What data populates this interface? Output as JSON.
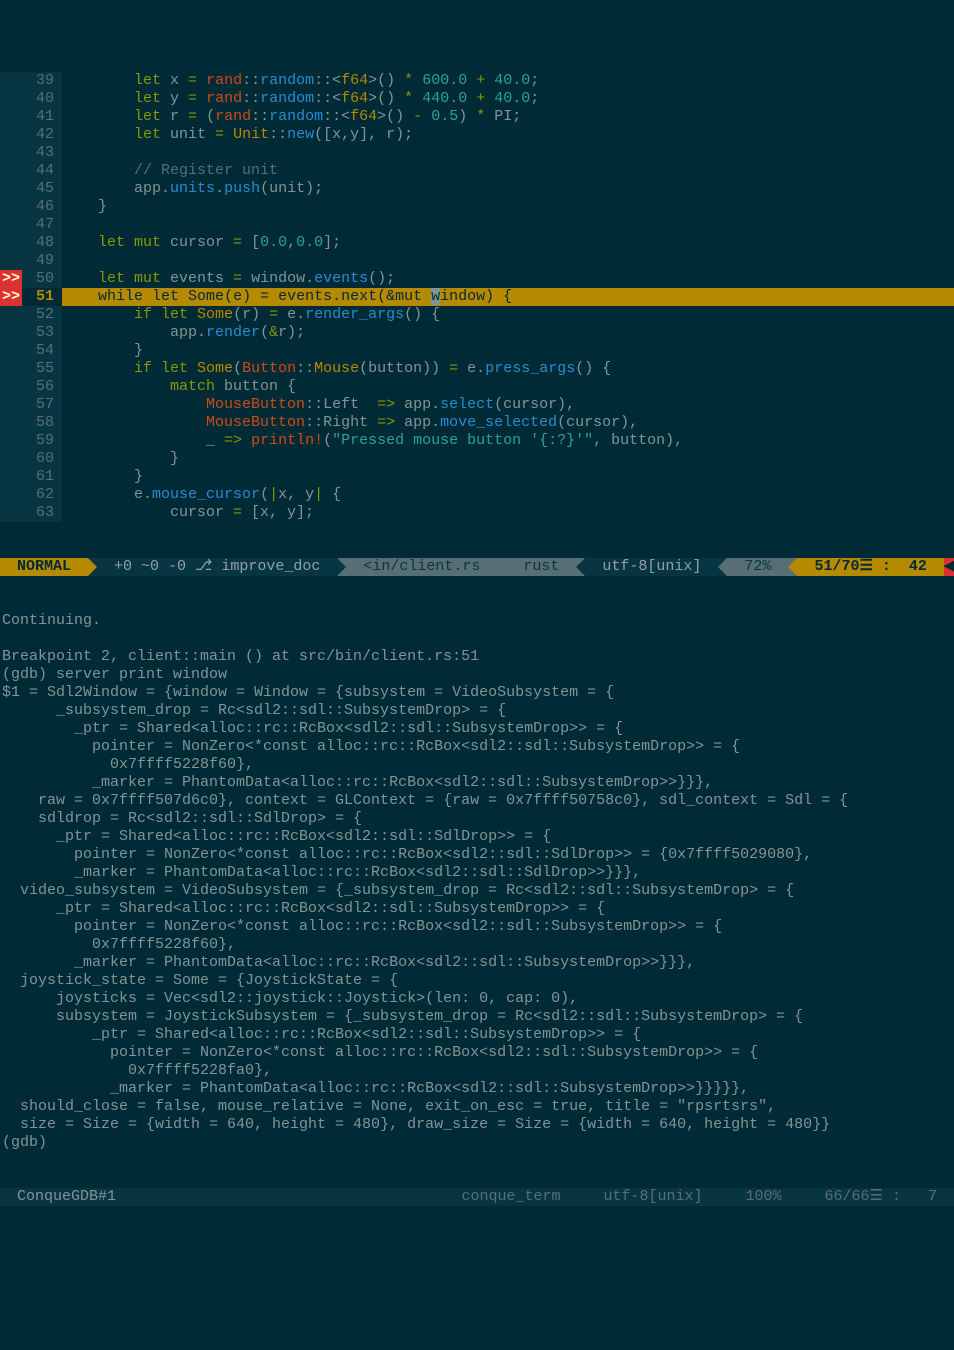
{
  "editor": {
    "lines": [
      {
        "n": 39,
        "sign": "",
        "segs": [
          [
            "        ",
            ""
          ],
          [
            "let",
            "kw"
          ],
          [
            " x ",
            ""
          ],
          [
            "=",
            "op"
          ],
          [
            " ",
            ""
          ],
          [
            "rand",
            "pth"
          ],
          [
            "::",
            ""
          ],
          [
            "random",
            "fn"
          ],
          [
            "::<",
            ""
          ],
          [
            "f64",
            "ty"
          ],
          [
            ">() ",
            ""
          ],
          [
            "*",
            "op"
          ],
          [
            " ",
            ""
          ],
          [
            "600.0",
            "num"
          ],
          [
            " ",
            ""
          ],
          [
            "+",
            "op"
          ],
          [
            " ",
            ""
          ],
          [
            "40.0",
            "num"
          ],
          [
            ";",
            ""
          ]
        ]
      },
      {
        "n": 40,
        "sign": "",
        "segs": [
          [
            "        ",
            ""
          ],
          [
            "let",
            "kw"
          ],
          [
            " y ",
            ""
          ],
          [
            "=",
            "op"
          ],
          [
            " ",
            ""
          ],
          [
            "rand",
            "pth"
          ],
          [
            "::",
            ""
          ],
          [
            "random",
            "fn"
          ],
          [
            "::<",
            ""
          ],
          [
            "f64",
            "ty"
          ],
          [
            ">() ",
            ""
          ],
          [
            "*",
            "op"
          ],
          [
            " ",
            ""
          ],
          [
            "440.0",
            "num"
          ],
          [
            " ",
            ""
          ],
          [
            "+",
            "op"
          ],
          [
            " ",
            ""
          ],
          [
            "40.0",
            "num"
          ],
          [
            ";",
            ""
          ]
        ]
      },
      {
        "n": 41,
        "sign": "",
        "segs": [
          [
            "        ",
            ""
          ],
          [
            "let",
            "kw"
          ],
          [
            " r ",
            ""
          ],
          [
            "=",
            "op"
          ],
          [
            " (",
            ""
          ],
          [
            "rand",
            "pth"
          ],
          [
            "::",
            ""
          ],
          [
            "random",
            "fn"
          ],
          [
            "::<",
            ""
          ],
          [
            "f64",
            "ty"
          ],
          [
            ">() ",
            ""
          ],
          [
            "-",
            "op"
          ],
          [
            " ",
            ""
          ],
          [
            "0.5",
            "num"
          ],
          [
            ") ",
            ""
          ],
          [
            "*",
            "op"
          ],
          [
            " ",
            ""
          ],
          [
            "PI",
            ""
          ],
          [
            ";",
            ""
          ]
        ]
      },
      {
        "n": 42,
        "sign": "",
        "segs": [
          [
            "        ",
            ""
          ],
          [
            "let",
            "kw"
          ],
          [
            " unit ",
            ""
          ],
          [
            "=",
            "op"
          ],
          [
            " ",
            ""
          ],
          [
            "Unit",
            "ty"
          ],
          [
            "::",
            ""
          ],
          [
            "new",
            "fn"
          ],
          [
            "([x,y], r);",
            ""
          ]
        ]
      },
      {
        "n": 43,
        "sign": "",
        "segs": [
          [
            "",
            ""
          ]
        ]
      },
      {
        "n": 44,
        "sign": "",
        "segs": [
          [
            "        ",
            ""
          ],
          [
            "// Register unit",
            "cm"
          ]
        ]
      },
      {
        "n": 45,
        "sign": "",
        "segs": [
          [
            "        app",
            ""
          ],
          [
            ".",
            ""
          ],
          [
            "units",
            "fn"
          ],
          [
            ".",
            ""
          ],
          [
            "push",
            "fn"
          ],
          [
            "(unit);",
            ""
          ]
        ]
      },
      {
        "n": 46,
        "sign": "",
        "segs": [
          [
            "    }",
            ""
          ]
        ]
      },
      {
        "n": 47,
        "sign": "",
        "segs": [
          [
            "",
            ""
          ]
        ]
      },
      {
        "n": 48,
        "sign": "",
        "segs": [
          [
            "    ",
            ""
          ],
          [
            "let mut",
            "kw"
          ],
          [
            " cursor ",
            ""
          ],
          [
            "=",
            "op"
          ],
          [
            " [",
            ""
          ],
          [
            "0.0",
            "num"
          ],
          [
            ",",
            ""
          ],
          [
            "0.0",
            "num"
          ],
          [
            "];",
            ""
          ]
        ]
      },
      {
        "n": 49,
        "sign": "",
        "segs": [
          [
            "",
            ""
          ]
        ]
      },
      {
        "n": 50,
        "sign": ">>",
        "segs": [
          [
            "    ",
            ""
          ],
          [
            "let mut",
            "kw"
          ],
          [
            " events ",
            ""
          ],
          [
            "=",
            "op"
          ],
          [
            " window",
            ""
          ],
          [
            ".",
            ""
          ],
          [
            "events",
            "fn"
          ],
          [
            "();",
            ""
          ]
        ]
      },
      {
        "n": 51,
        "sign": ">>",
        "cursor": true,
        "segs": [
          [
            "    ",
            ""
          ],
          [
            "while let",
            "kw"
          ],
          [
            " ",
            ""
          ],
          [
            "Some",
            "ty"
          ],
          [
            "(e) ",
            ""
          ],
          [
            "=",
            "op"
          ],
          [
            " events.next(",
            ""
          ],
          [
            "&mut",
            "kw"
          ],
          [
            " ",
            ""
          ],
          [
            "w",
            "",
            "cur"
          ],
          [
            "indow) {",
            ""
          ]
        ]
      },
      {
        "n": 52,
        "sign": "",
        "segs": [
          [
            "        ",
            ""
          ],
          [
            "if let",
            "kw"
          ],
          [
            " ",
            ""
          ],
          [
            "Some",
            "ty"
          ],
          [
            "(r) ",
            ""
          ],
          [
            "=",
            "op"
          ],
          [
            " e",
            ""
          ],
          [
            ".",
            ""
          ],
          [
            "render_args",
            "fn"
          ],
          [
            "() {",
            ""
          ]
        ]
      },
      {
        "n": 53,
        "sign": "",
        "segs": [
          [
            "            app",
            ""
          ],
          [
            ".",
            ""
          ],
          [
            "render",
            "fn"
          ],
          [
            "(",
            ""
          ],
          [
            "&",
            "op"
          ],
          [
            "r);",
            ""
          ]
        ]
      },
      {
        "n": 54,
        "sign": "",
        "segs": [
          [
            "        }",
            ""
          ]
        ]
      },
      {
        "n": 55,
        "sign": "",
        "segs": [
          [
            "        ",
            ""
          ],
          [
            "if let",
            "kw"
          ],
          [
            " ",
            ""
          ],
          [
            "Some",
            "ty"
          ],
          [
            "(",
            ""
          ],
          [
            "Button",
            "pth"
          ],
          [
            "::",
            ""
          ],
          [
            "Mouse",
            "ty"
          ],
          [
            "(button)) ",
            ""
          ],
          [
            "=",
            "op"
          ],
          [
            " e",
            ""
          ],
          [
            ".",
            ""
          ],
          [
            "press_args",
            "fn"
          ],
          [
            "() {",
            ""
          ]
        ]
      },
      {
        "n": 56,
        "sign": "",
        "segs": [
          [
            "            ",
            ""
          ],
          [
            "match",
            "kw"
          ],
          [
            " button {",
            ""
          ]
        ]
      },
      {
        "n": 57,
        "sign": "",
        "segs": [
          [
            "                ",
            ""
          ],
          [
            "MouseButton",
            "pth"
          ],
          [
            "::",
            ""
          ],
          [
            "Left  ",
            ""
          ],
          [
            "=>",
            "op"
          ],
          [
            " app",
            ""
          ],
          [
            ".",
            ""
          ],
          [
            "select",
            "fn"
          ],
          [
            "(cursor),",
            ""
          ]
        ]
      },
      {
        "n": 58,
        "sign": "",
        "segs": [
          [
            "                ",
            ""
          ],
          [
            "MouseButton",
            "pth"
          ],
          [
            "::",
            ""
          ],
          [
            "Right ",
            ""
          ],
          [
            "=>",
            "op"
          ],
          [
            " app",
            ""
          ],
          [
            ".",
            ""
          ],
          [
            "move_selected",
            "fn"
          ],
          [
            "(cursor),",
            ""
          ]
        ]
      },
      {
        "n": 59,
        "sign": "",
        "segs": [
          [
            "                _ ",
            ""
          ],
          [
            "=>",
            "op"
          ],
          [
            " ",
            ""
          ],
          [
            "println!",
            "pth"
          ],
          [
            "(",
            ""
          ],
          [
            "\"Pressed mouse button '{:?}'\"",
            "str"
          ],
          [
            ", button),",
            ""
          ]
        ]
      },
      {
        "n": 60,
        "sign": "",
        "segs": [
          [
            "            }",
            ""
          ]
        ]
      },
      {
        "n": 61,
        "sign": "",
        "segs": [
          [
            "        }",
            ""
          ]
        ]
      },
      {
        "n": 62,
        "sign": "",
        "segs": [
          [
            "        e",
            ""
          ],
          [
            ".",
            ""
          ],
          [
            "mouse_cursor",
            "fn"
          ],
          [
            "(",
            ""
          ],
          [
            "|",
            "op"
          ],
          [
            "x, y",
            ""
          ],
          [
            "|",
            "op"
          ],
          [
            " {",
            ""
          ]
        ]
      },
      {
        "n": 63,
        "sign": "",
        "segs": [
          [
            "            cursor ",
            ""
          ],
          [
            "=",
            "op"
          ],
          [
            " [x, y];",
            ""
          ]
        ]
      }
    ]
  },
  "status1": {
    "mode": " NORMAL ",
    "git": " +0 ~0 -0 ⎇ improve_doc ",
    "file": " <in/client.rs ",
    "filetype": " rust ",
    "encoding": " utf-8[unix] ",
    "percent": " 72% ",
    "position": " 51/70☰ :  42 "
  },
  "terminal": {
    "lines": [
      "Continuing.",
      "",
      "Breakpoint 2, client::main () at src/bin/client.rs:51",
      "(gdb) server print window",
      "$1 = Sdl2Window = {window = Window = {subsystem = VideoSubsystem = {",
      "      _subsystem_drop = Rc<sdl2::sdl::SubsystemDrop> = {",
      "        _ptr = Shared<alloc::rc::RcBox<sdl2::sdl::SubsystemDrop>> = {",
      "          pointer = NonZero<*const alloc::rc::RcBox<sdl2::sdl::SubsystemDrop>> = {",
      "            0x7ffff5228f60},",
      "          _marker = PhantomData<alloc::rc::RcBox<sdl2::sdl::SubsystemDrop>>}}},",
      "    raw = 0x7ffff507d6c0}, context = GLContext = {raw = 0x7ffff50758c0}, sdl_context = Sdl = {",
      "    sdldrop = Rc<sdl2::sdl::SdlDrop> = {",
      "      _ptr = Shared<alloc::rc::RcBox<sdl2::sdl::SdlDrop>> = {",
      "        pointer = NonZero<*const alloc::rc::RcBox<sdl2::sdl::SdlDrop>> = {0x7ffff5029080},",
      "        _marker = PhantomData<alloc::rc::RcBox<sdl2::sdl::SdlDrop>>}}},",
      "  video_subsystem = VideoSubsystem = {_subsystem_drop = Rc<sdl2::sdl::SubsystemDrop> = {",
      "      _ptr = Shared<alloc::rc::RcBox<sdl2::sdl::SubsystemDrop>> = {",
      "        pointer = NonZero<*const alloc::rc::RcBox<sdl2::sdl::SubsystemDrop>> = {",
      "          0x7ffff5228f60},",
      "        _marker = PhantomData<alloc::rc::RcBox<sdl2::sdl::SubsystemDrop>>}}},",
      "  joystick_state = Some = {JoystickState = {",
      "      joysticks = Vec<sdl2::joystick::Joystick>(len: 0, cap: 0),",
      "      subsystem = JoystickSubsystem = {_subsystem_drop = Rc<sdl2::sdl::SubsystemDrop> = {",
      "          _ptr = Shared<alloc::rc::RcBox<sdl2::sdl::SubsystemDrop>> = {",
      "            pointer = NonZero<*const alloc::rc::RcBox<sdl2::sdl::SubsystemDrop>> = {",
      "              0x7ffff5228fa0},",
      "            _marker = PhantomData<alloc::rc::RcBox<sdl2::sdl::SubsystemDrop>>}}}}},",
      "  should_close = false, mouse_relative = None, exit_on_esc = true, title = \"rpsrtsrs\",",
      "  size = Size = {width = 640, height = 480}, draw_size = Size = {width = 640, height = 480}}",
      "(gdb) "
    ]
  },
  "status2": {
    "file": " ConqueGDB#1",
    "filetype": " conque_term ",
    "encoding": " utf-8[unix] ",
    "percent": " 100% ",
    "position": " 66/66☰ :   7 "
  }
}
